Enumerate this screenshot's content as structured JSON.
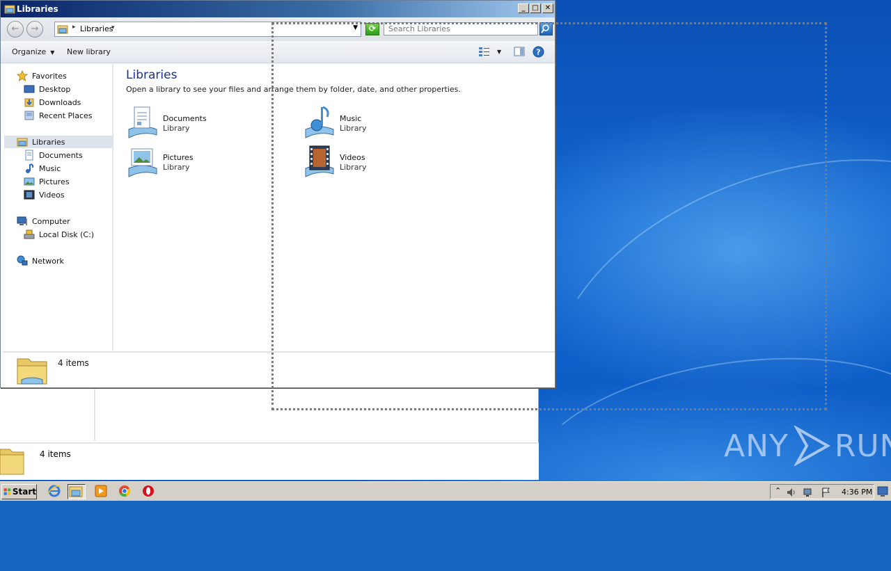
{
  "window": {
    "title": "Libraries",
    "caption_buttons": [
      "minimize",
      "maximize",
      "close"
    ]
  },
  "address_bar": {
    "crumb": "Libraries",
    "search_placeholder": "Search Libraries"
  },
  "command_bar": {
    "organize": "Organize",
    "new_library": "New library"
  },
  "nav_pane": {
    "favorites": {
      "label": "Favorites",
      "items": [
        {
          "label": "Desktop",
          "icon": "desktop-icon"
        },
        {
          "label": "Downloads",
          "icon": "downloads-icon"
        },
        {
          "label": "Recent Places",
          "icon": "recent-places-icon"
        }
      ]
    },
    "libraries": {
      "label": "Libraries",
      "items": [
        {
          "label": "Documents",
          "icon": "documents-icon"
        },
        {
          "label": "Music",
          "icon": "music-icon"
        },
        {
          "label": "Pictures",
          "icon": "pictures-icon"
        },
        {
          "label": "Videos",
          "icon": "videos-icon"
        }
      ]
    },
    "computer": {
      "label": "Computer",
      "items": [
        {
          "label": "Local Disk (C:)",
          "icon": "local-disk-icon"
        }
      ]
    },
    "network": {
      "label": "Network"
    }
  },
  "content": {
    "heading": "Libraries",
    "subtext": "Open a library to see your files and arrange them by folder, date, and other properties.",
    "libraries": [
      {
        "name": "Documents",
        "kind": "Library",
        "icon": "documents-library-icon"
      },
      {
        "name": "Music",
        "kind": "Library",
        "icon": "music-library-icon"
      },
      {
        "name": "Pictures",
        "kind": "Library",
        "icon": "pictures-library-icon"
      },
      {
        "name": "Videos",
        "kind": "Library",
        "icon": "videos-library-icon"
      }
    ]
  },
  "status": {
    "count": "4 items"
  },
  "background_window": {
    "status_count": "4 items"
  },
  "taskbar": {
    "start_label": "Start",
    "apps": [
      "internet-explorer-icon",
      "windows-explorer-icon",
      "media-player-icon",
      "chrome-icon",
      "opera-icon"
    ],
    "clock": "4:36 PM"
  },
  "watermark": {
    "left_text": "ANY",
    "right_text": "RUN"
  },
  "colors": {
    "desktop_blue": "#1064cf",
    "title_blue": "#0a246a",
    "heading_blue": "#1e3287",
    "selection": "#dde3ea"
  }
}
